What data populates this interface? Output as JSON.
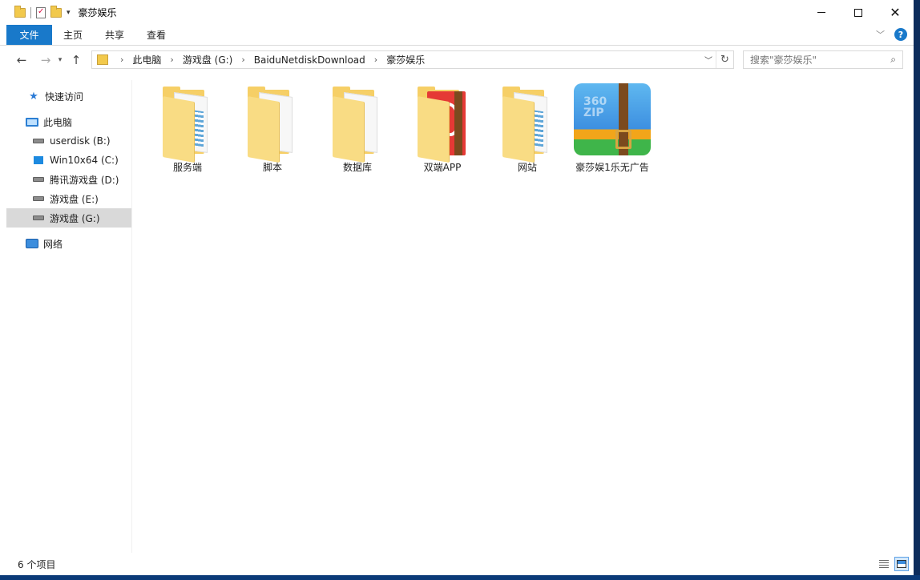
{
  "window": {
    "title": "豪莎娱乐"
  },
  "ribbon": {
    "tabs": [
      {
        "label": "文件"
      },
      {
        "label": "主页"
      },
      {
        "label": "共享"
      },
      {
        "label": "查看"
      }
    ]
  },
  "address": {
    "crumbs": [
      "此电脑",
      "游戏盘 (G:)",
      "BaiduNetdiskDownload",
      "豪莎娱乐"
    ]
  },
  "search": {
    "placeholder": "搜索\"豪莎娱乐\""
  },
  "sidebar": {
    "items": [
      {
        "label": "快速访问",
        "icon": "star-icon"
      },
      {
        "label": "此电脑",
        "icon": "pc-icon"
      },
      {
        "label": "userdisk (B:)",
        "icon": "drive-icon"
      },
      {
        "label": "Win10x64 (C:)",
        "icon": "windows-drive-icon"
      },
      {
        "label": "腾讯游戏盘 (D:)",
        "icon": "drive-icon"
      },
      {
        "label": "游戏盘 (E:)",
        "icon": "drive-icon"
      },
      {
        "label": "游戏盘 (G:)",
        "icon": "drive-icon",
        "selected": true
      },
      {
        "label": "网络",
        "icon": "network-icon"
      }
    ]
  },
  "content": {
    "items": [
      {
        "label": "服务端",
        "icon": "folder-icon"
      },
      {
        "label": "脚本",
        "icon": "folder-icon"
      },
      {
        "label": "数据库",
        "icon": "folder-icon"
      },
      {
        "label": "双端APP",
        "icon": "folder-icon"
      },
      {
        "label": "网站",
        "icon": "folder-icon"
      },
      {
        "label": "豪莎娱1乐无广告",
        "icon": "zip-archive-icon",
        "badge": "360\nZIP"
      }
    ]
  },
  "status": {
    "count": "6 个项目"
  },
  "colors": {
    "accent": "#1979ca",
    "selection": "#d9d9d9",
    "folder": "#f6cf66"
  }
}
